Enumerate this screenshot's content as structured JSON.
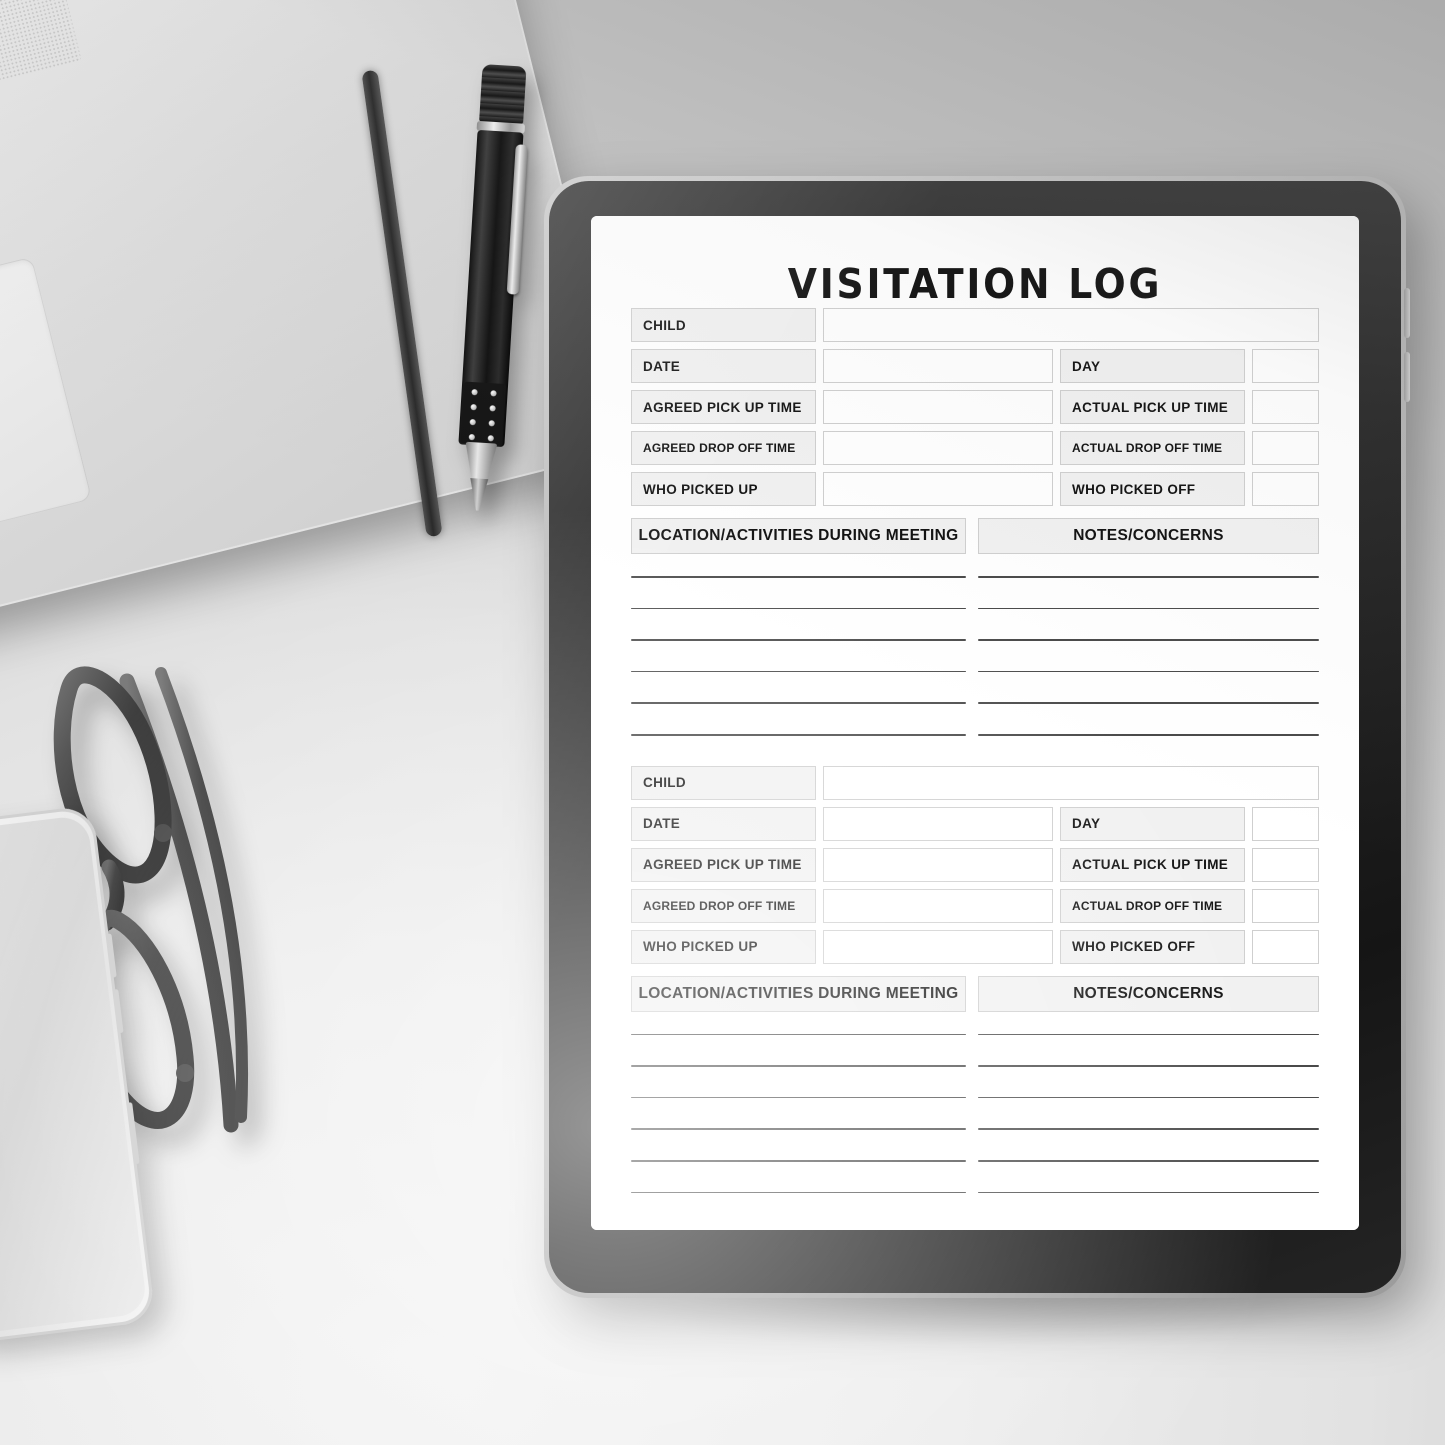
{
  "scene": {
    "background_color": "#e9e9e9",
    "objects": [
      {
        "name": "laptop",
        "description": "silver laptop, top-left, partially cropped"
      },
      {
        "name": "pen",
        "description": "black ballpoint pen with silver tip"
      },
      {
        "name": "eyeglasses",
        "description": "folded dark-framed eyeglasses"
      },
      {
        "name": "smartphone",
        "description": "white smartphone in clear case"
      },
      {
        "name": "tablet",
        "description": "black-bezel tablet displaying a printable form"
      }
    ]
  },
  "document": {
    "title": "VISITATION LOG",
    "sections": [
      {
        "id": "entry-1",
        "fields": [
          {
            "label": "CHILD",
            "value": "",
            "span": "full"
          },
          {
            "label": "DATE",
            "value": "",
            "label2": "DAY",
            "value2": ""
          },
          {
            "label": "AGREED PICK UP TIME",
            "value": "",
            "label2": "ACTUAL PICK UP TIME",
            "value2": ""
          },
          {
            "label": "AGREED DROP OFF TIME",
            "value": "",
            "label2": "ACTUAL DROP OFF TIME",
            "value2": ""
          },
          {
            "label": "WHO PICKED UP",
            "value": "",
            "label2": "WHO PICKED OFF",
            "value2": ""
          }
        ],
        "headers": {
          "left": "LOCATION/ACTIVITIES DURING MEETING",
          "right": "NOTES/CONCERNS"
        },
        "writing_lines": 6
      },
      {
        "id": "entry-2",
        "fields": [
          {
            "label": "CHILD",
            "value": "",
            "span": "full"
          },
          {
            "label": "DATE",
            "value": "",
            "label2": "DAY",
            "value2": ""
          },
          {
            "label": "AGREED PICK UP TIME",
            "value": "",
            "label2": "ACTUAL PICK UP TIME",
            "value2": ""
          },
          {
            "label": "AGREED DROP OFF TIME",
            "value": "",
            "label2": "ACTUAL DROP OFF TIME",
            "value2": ""
          },
          {
            "label": "WHO PICKED UP",
            "value": "",
            "label2": "WHO PICKED OFF",
            "value2": ""
          }
        ],
        "headers": {
          "left": "LOCATION/ACTIVITIES DURING MEETING",
          "right": "NOTES/CONCERNS"
        },
        "writing_lines": 6
      }
    ],
    "colors": {
      "label_fill": "#f1f1f1",
      "border": "#cfcfcf",
      "text": "#111111",
      "rule": "#4a4a4a",
      "paper": "#ffffff"
    }
  }
}
